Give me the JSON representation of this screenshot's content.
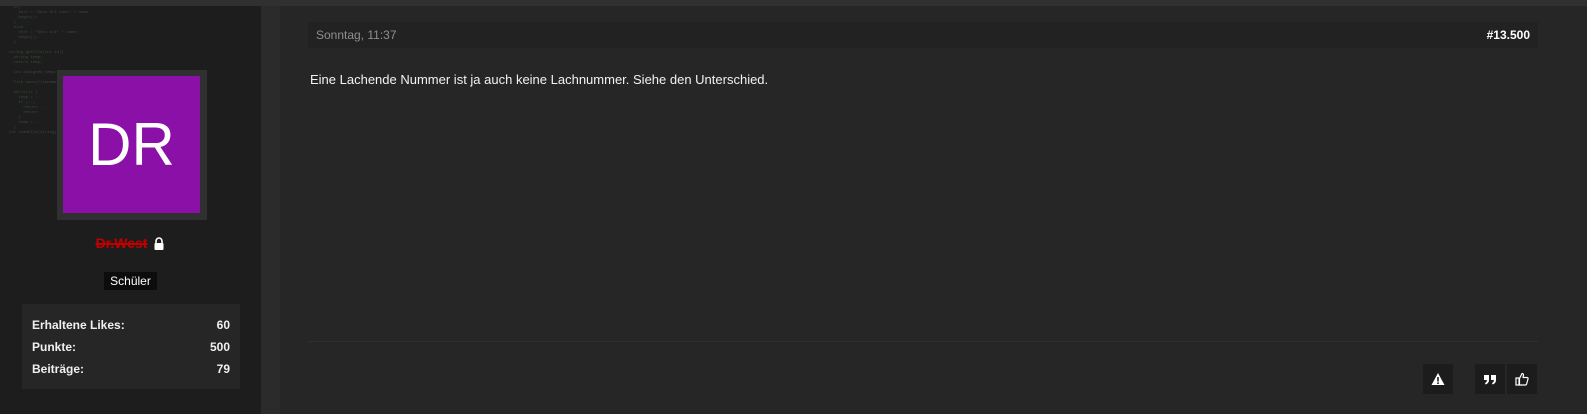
{
  "user": {
    "avatar_initials": "DR",
    "avatar_color": "#8b10a7",
    "name": "Dr.West",
    "name_color": "#c00000",
    "name_icon": "lock-icon",
    "role": "Schüler"
  },
  "stats": [
    {
      "label": "Erhaltene Likes:",
      "value": "60"
    },
    {
      "label": "Punkte:",
      "value": "500"
    },
    {
      "label": "Beiträge:",
      "value": "79"
    }
  ],
  "post": {
    "date": "Sonntag, 11:37",
    "number": "#13.500",
    "text": "Eine Lachende Nummer ist ja auch keine Lachnummer. Siehe den Unterschied."
  },
  "actions": [
    {
      "name": "report",
      "icon": "warning-icon"
    },
    {
      "name": "quote",
      "icon": "quote-icon"
    },
    {
      "name": "like",
      "icon": "thumbs-up-icon"
    }
  ]
}
